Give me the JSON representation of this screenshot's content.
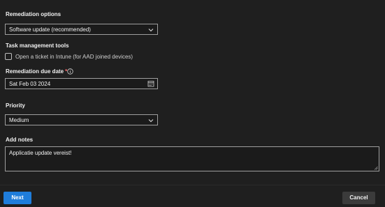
{
  "remediation": {
    "label": "Remediation options",
    "selected": "Software update (recommended)"
  },
  "tasks": {
    "label": "Task management tools",
    "checkbox_label": "Open a ticket in Intune (for AAD joined devices)"
  },
  "due_date": {
    "label": "Remediation due date",
    "required_mark": "*",
    "value": "Sat Feb 03 2024"
  },
  "priority": {
    "label": "Priority",
    "selected": "Medium"
  },
  "notes": {
    "label": "Add notes",
    "value": "Applicatie update vereist!"
  },
  "buttons": {
    "next": "Next",
    "cancel": "Cancel"
  },
  "colors": {
    "background": "#1f1f1f",
    "accent": "#1f7ddb",
    "required": "#ff6b6b"
  }
}
